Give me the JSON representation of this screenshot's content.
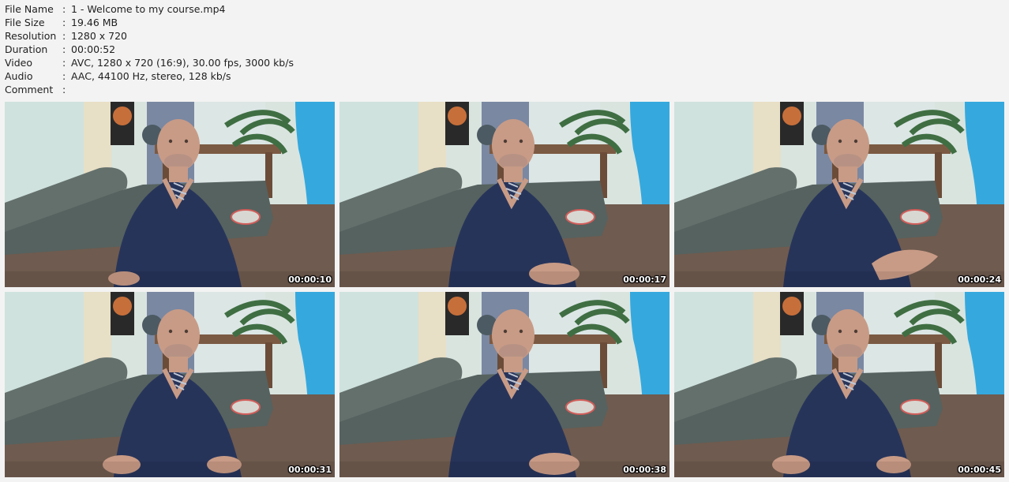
{
  "file_info": [
    {
      "label": "File Name",
      "value": "1 - Welcome to my course.mp4"
    },
    {
      "label": "File Size",
      "value": "19.46 MB"
    },
    {
      "label": "Resolution",
      "value": "1280 x 720"
    },
    {
      "label": "Duration",
      "value": "00:00:52"
    },
    {
      "label": "Video",
      "value": "AVC, 1280 x 720 (16:9), 30.00 fps, 3000 kb/s"
    },
    {
      "label": "Audio",
      "value": "AAC, 44100 Hz, stereo, 128 kb/s"
    },
    {
      "label": "Comment",
      "value": ""
    }
  ],
  "separator": ":",
  "thumbnails": [
    {
      "timestamp": "00:00:10"
    },
    {
      "timestamp": "00:00:17"
    },
    {
      "timestamp": "00:00:24"
    },
    {
      "timestamp": "00:00:31"
    },
    {
      "timestamp": "00:00:38"
    },
    {
      "timestamp": "00:00:45"
    }
  ],
  "colors": {
    "page_background": "#f3f3f3",
    "wall": "#d9e4df",
    "curtain": "#35a9de",
    "couch": "#56625f",
    "shirt": "#27345a",
    "skin": "#c89b86",
    "floor": "#6f5b4f"
  }
}
